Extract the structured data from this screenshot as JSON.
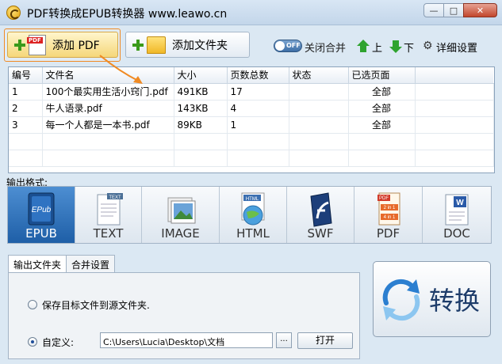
{
  "window": {
    "title": "PDF转换成EPUB转换器 www.leawo.cn",
    "minimize": "—",
    "maximize": "□",
    "close": "✕"
  },
  "toolbar": {
    "add_pdf": "添加 PDF",
    "add_folder": "添加文件夹",
    "toggle_state": "OFF",
    "merge_label": "关闭合并",
    "up_label": "上",
    "down_label": "下",
    "settings_label": "详细设置"
  },
  "table": {
    "headers": [
      "编号",
      "文件名",
      "大小",
      "页数总数",
      "状态",
      "已选页面"
    ],
    "rows": [
      [
        "1",
        "100个最实用生活小窍门.pdf",
        "491KB",
        "17",
        "",
        "全部"
      ],
      [
        "2",
        "牛人语录.pdf",
        "143KB",
        "4",
        "",
        "全部"
      ],
      [
        "3",
        "每一个人都是一本书.pdf",
        "89KB",
        "1",
        "",
        "全部"
      ]
    ]
  },
  "output": {
    "label": "输出格式:",
    "formats": [
      "EPUB",
      "TEXT",
      "IMAGE",
      "HTML",
      "SWF",
      "PDF",
      "DOC"
    ],
    "selected": "EPUB",
    "icon_labels": {
      "epub": "EPub",
      "text": "TEXT",
      "html": "HTML",
      "pdf": "PDF",
      "pdf_tag1": "2 in 1",
      "pdf_tag2": "4 in 1"
    }
  },
  "tabs": [
    "输出文件夹",
    "合并设置"
  ],
  "folder": {
    "option_source": "保存目标文件到源文件夹.",
    "option_custom": "自定义:",
    "path": "C:\\Users\\Lucia\\Desktop\\文档",
    "browse": "...",
    "open": "打开"
  },
  "convert": {
    "label": "转换"
  },
  "colors": {
    "accent": "#f08a23",
    "selected_format": "#1e5fa7",
    "green": "#2fa32f"
  }
}
